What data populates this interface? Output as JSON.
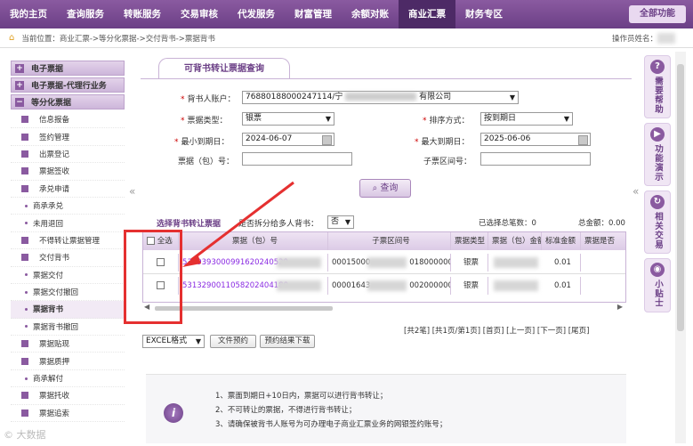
{
  "topnav": {
    "items": [
      "我的主页",
      "查询服务",
      "转账服务",
      "交易审核",
      "代发服务",
      "财富管理",
      "余额对账",
      "商业汇票",
      "财务专区"
    ],
    "active_index": 7,
    "all_functions": "全部功能"
  },
  "breadcrumb": {
    "text": "当前位置：商业汇票->等分化票据->交付背书->票据背书",
    "operator": "操作员姓名："
  },
  "sidebar": {
    "heads": [
      "电子票据",
      "电子票据-代理行业务",
      "等分化票据"
    ],
    "items": [
      {
        "label": "信息报备",
        "type": "sq"
      },
      {
        "label": "签约管理",
        "type": "sq"
      },
      {
        "label": "出票登记",
        "type": "sq"
      },
      {
        "label": "票据签收",
        "type": "sq"
      },
      {
        "label": "承兑申请",
        "type": "sq"
      },
      {
        "label": "商承承兑",
        "type": "dot"
      },
      {
        "label": "未用退回",
        "type": "dot"
      },
      {
        "label": "不得转让票据管理",
        "type": "sq"
      },
      {
        "label": "交付背书",
        "type": "sq"
      },
      {
        "label": "票据交付",
        "type": "dot"
      },
      {
        "label": "票据交付撤回",
        "type": "dot"
      },
      {
        "label": "票据背书",
        "type": "dot",
        "active": true
      },
      {
        "label": "票据背书撤回",
        "type": "dot"
      },
      {
        "label": "票据贴现",
        "type": "sq"
      },
      {
        "label": "票据质押",
        "type": "sq"
      },
      {
        "label": "商承解付",
        "type": "dot"
      },
      {
        "label": "票据托收",
        "type": "sq"
      },
      {
        "label": "票据追索",
        "type": "sq"
      }
    ]
  },
  "main": {
    "tab_title": "可背书转让票据查询",
    "form": {
      "endorser_label": "背书人账户：",
      "endorser_value": "76880188000247114/宁",
      "endorser_suffix": "有限公司",
      "bill_type_label": "票据类型：",
      "bill_type_value": "银票",
      "sort_label": "排序方式：",
      "sort_value": "按到期日",
      "min_due_label": "最小到期日：",
      "min_due_value": "2024-06-07",
      "max_due_label": "最大到期日：",
      "max_due_value": "2025-06-06",
      "bill_no_label": "票据（包）号：",
      "range_label": "子票区间号：",
      "query_button": "查询"
    },
    "selection": {
      "title": "选择背书转让票据",
      "split_label": "是否拆分给多人背书：",
      "split_value": "否",
      "total_count": "已选择总笔数：0",
      "total_amount": "总金额：0.00"
    },
    "table": {
      "headers": [
        "全选",
        "票据（包）号",
        "子票区间号",
        "票据类型",
        "票据（包）金额",
        "标准金额",
        "票据是否"
      ],
      "rows": [
        {
          "bill_no": "5309393000991620240529",
          "range_no": "00015000",
          "range_no_end": "0180000000",
          "type": "银票",
          "std_amount": "0.01"
        },
        {
          "bill_no": "5313290011058202404180",
          "range_no": "00001643",
          "range_no_end": "0020000000",
          "type": "银票",
          "std_amount": "0.01"
        }
      ]
    },
    "pager": "[共2笔] [共1页/第1页] [首页] [上一页] [下一页] [尾页]",
    "export_format": "EXCEL格式",
    "file_reserve_button": "文件预约",
    "reserve_download_button": "预约结果下载",
    "notice": {
      "line1": "1、票面到期日+10日内，票据可以进行背书转让；",
      "line2": "2、不可转让的票据，不得进行背书转让；",
      "line3": "3、请确保被背书人账号为可办理电子商业汇票业务的网银签约账号；"
    }
  },
  "rail": {
    "tiles": [
      {
        "icon": "?",
        "label": "需要帮助"
      },
      {
        "icon": "▶",
        "label": "功能演示"
      },
      {
        "icon": "↻",
        "label": "相关交易"
      },
      {
        "icon": "◉",
        "label": "小贴士"
      }
    ]
  },
  "watermark": "© 大数据"
}
